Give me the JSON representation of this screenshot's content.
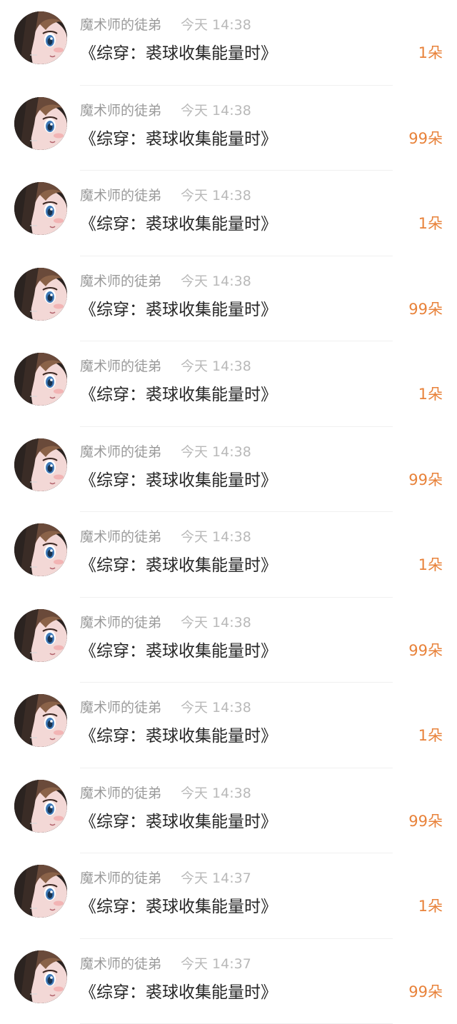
{
  "messages": [
    {
      "name": "魔术师的徒弟",
      "time": "今天 14:38",
      "title": "《综穿：裘球收集能量时》",
      "gift": "1朵"
    },
    {
      "name": "魔术师的徒弟",
      "time": "今天 14:38",
      "title": "《综穿：裘球收集能量时》",
      "gift": "99朵"
    },
    {
      "name": "魔术师的徒弟",
      "time": "今天 14:38",
      "title": "《综穿：裘球收集能量时》",
      "gift": "1朵"
    },
    {
      "name": "魔术师的徒弟",
      "time": "今天 14:38",
      "title": "《综穿：裘球收集能量时》",
      "gift": "99朵"
    },
    {
      "name": "魔术师的徒弟",
      "time": "今天 14:38",
      "title": "《综穿：裘球收集能量时》",
      "gift": "1朵"
    },
    {
      "name": "魔术师的徒弟",
      "time": "今天 14:38",
      "title": "《综穿：裘球收集能量时》",
      "gift": "99朵"
    },
    {
      "name": "魔术师的徒弟",
      "time": "今天 14:38",
      "title": "《综穿：裘球收集能量时》",
      "gift": "1朵"
    },
    {
      "name": "魔术师的徒弟",
      "time": "今天 14:38",
      "title": "《综穿：裘球收集能量时》",
      "gift": "99朵"
    },
    {
      "name": "魔术师的徒弟",
      "time": "今天 14:38",
      "title": "《综穿：裘球收集能量时》",
      "gift": "1朵"
    },
    {
      "name": "魔术师的徒弟",
      "time": "今天 14:38",
      "title": "《综穿：裘球收集能量时》",
      "gift": "99朵"
    },
    {
      "name": "魔术师的徒弟",
      "time": "今天 14:37",
      "title": "《综穿：裘球收集能量时》",
      "gift": "1朵"
    },
    {
      "name": "魔术师的徒弟",
      "time": "今天 14:37",
      "title": "《综穿：裘球收集能量时》",
      "gift": "99朵"
    }
  ],
  "avatar_icon": "anime-character-avatar",
  "colors": {
    "name": "#9a9a9a",
    "time": "#b9b9b9",
    "title": "#262626",
    "gift": "#e8823a",
    "divider": "#f0f0f0"
  }
}
